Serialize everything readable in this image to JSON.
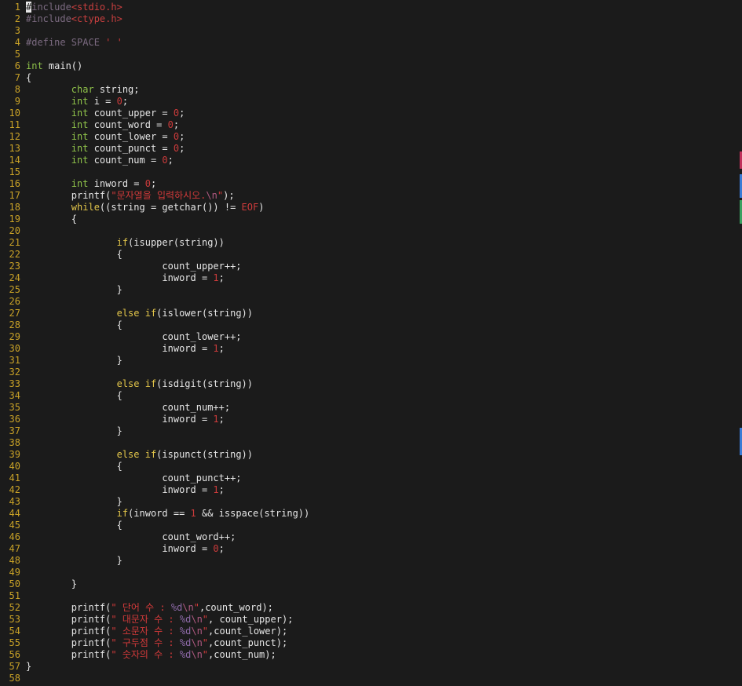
{
  "editor": {
    "colors": {
      "background": "#1b1b1b",
      "line_number": "#c9a227",
      "plain": "#e6e6e6",
      "preproc": "#7b6a80",
      "include_path": "#c83f3f",
      "type_keyword": "#8fc24a",
      "control_keyword": "#e2c54a",
      "number": "#cc3b3b",
      "string": "#d23a3a"
    },
    "lines": [
      {
        "n": "1",
        "tokens": [
          {
            "t": "#",
            "c": "cursor"
          },
          {
            "t": "include",
            "c": "pre"
          },
          {
            "t": "<stdio.h>",
            "c": "inc"
          }
        ]
      },
      {
        "n": "2",
        "tokens": [
          {
            "t": "#include",
            "c": "pre"
          },
          {
            "t": "<ctype.h>",
            "c": "inc"
          }
        ]
      },
      {
        "n": "3",
        "tokens": []
      },
      {
        "n": "4",
        "tokens": [
          {
            "t": "#define SPACE ",
            "c": "pre"
          },
          {
            "t": "' '",
            "c": "str"
          }
        ]
      },
      {
        "n": "5",
        "tokens": []
      },
      {
        "n": "6",
        "tokens": [
          {
            "t": "int",
            "c": "kw"
          },
          {
            "t": " main()",
            "c": "txt"
          }
        ]
      },
      {
        "n": "7",
        "tokens": [
          {
            "t": "{",
            "c": "txt"
          }
        ]
      },
      {
        "n": "8",
        "tokens": [
          {
            "t": "        ",
            "c": "txt"
          },
          {
            "t": "char",
            "c": "kw"
          },
          {
            "t": " string;",
            "c": "txt"
          }
        ]
      },
      {
        "n": "9",
        "tokens": [
          {
            "t": "        ",
            "c": "txt"
          },
          {
            "t": "int",
            "c": "kw"
          },
          {
            "t": " i = ",
            "c": "txt"
          },
          {
            "t": "0",
            "c": "num"
          },
          {
            "t": ";",
            "c": "txt"
          }
        ]
      },
      {
        "n": "10",
        "tokens": [
          {
            "t": "        ",
            "c": "txt"
          },
          {
            "t": "int",
            "c": "kw"
          },
          {
            "t": " count_upper = ",
            "c": "txt"
          },
          {
            "t": "0",
            "c": "num"
          },
          {
            "t": ";",
            "c": "txt"
          }
        ]
      },
      {
        "n": "11",
        "tokens": [
          {
            "t": "        ",
            "c": "txt"
          },
          {
            "t": "int",
            "c": "kw"
          },
          {
            "t": " count_word = ",
            "c": "txt"
          },
          {
            "t": "0",
            "c": "num"
          },
          {
            "t": ";",
            "c": "txt"
          }
        ]
      },
      {
        "n": "12",
        "tokens": [
          {
            "t": "        ",
            "c": "txt"
          },
          {
            "t": "int",
            "c": "kw"
          },
          {
            "t": " count_lower = ",
            "c": "txt"
          },
          {
            "t": "0",
            "c": "num"
          },
          {
            "t": ";",
            "c": "txt"
          }
        ]
      },
      {
        "n": "13",
        "tokens": [
          {
            "t": "        ",
            "c": "txt"
          },
          {
            "t": "int",
            "c": "kw"
          },
          {
            "t": " count_punct = ",
            "c": "txt"
          },
          {
            "t": "0",
            "c": "num"
          },
          {
            "t": ";",
            "c": "txt"
          }
        ]
      },
      {
        "n": "14",
        "tokens": [
          {
            "t": "        ",
            "c": "txt"
          },
          {
            "t": "int",
            "c": "kw"
          },
          {
            "t": " count_num = ",
            "c": "txt"
          },
          {
            "t": "0",
            "c": "num"
          },
          {
            "t": ";",
            "c": "txt"
          }
        ]
      },
      {
        "n": "15",
        "tokens": []
      },
      {
        "n": "16",
        "tokens": [
          {
            "t": "        ",
            "c": "txt"
          },
          {
            "t": "int",
            "c": "kw"
          },
          {
            "t": " inword = ",
            "c": "txt"
          },
          {
            "t": "0",
            "c": "num"
          },
          {
            "t": ";",
            "c": "txt"
          }
        ]
      },
      {
        "n": "17",
        "tokens": [
          {
            "t": "        printf(",
            "c": "txt"
          },
          {
            "t": "\"문자열을 입력하시오.",
            "c": "str"
          },
          {
            "t": "\\n",
            "c": "esc"
          },
          {
            "t": "\"",
            "c": "str"
          },
          {
            "t": ");",
            "c": "txt"
          }
        ]
      },
      {
        "n": "18",
        "tokens": [
          {
            "t": "        ",
            "c": "txt"
          },
          {
            "t": "while",
            "c": "ctl"
          },
          {
            "t": "((string = getchar()) != ",
            "c": "txt"
          },
          {
            "t": "EOF",
            "c": "num"
          },
          {
            "t": ")",
            "c": "txt"
          }
        ]
      },
      {
        "n": "19",
        "tokens": [
          {
            "t": "        {",
            "c": "txt"
          }
        ]
      },
      {
        "n": "20",
        "tokens": []
      },
      {
        "n": "21",
        "tokens": [
          {
            "t": "                ",
            "c": "txt"
          },
          {
            "t": "if",
            "c": "ctl"
          },
          {
            "t": "(isupper(string))",
            "c": "txt"
          }
        ]
      },
      {
        "n": "22",
        "tokens": [
          {
            "t": "                {",
            "c": "txt"
          }
        ]
      },
      {
        "n": "23",
        "tokens": [
          {
            "t": "                        count_upper++;",
            "c": "txt"
          }
        ]
      },
      {
        "n": "24",
        "tokens": [
          {
            "t": "                        inword = ",
            "c": "txt"
          },
          {
            "t": "1",
            "c": "num"
          },
          {
            "t": ";",
            "c": "txt"
          }
        ]
      },
      {
        "n": "25",
        "tokens": [
          {
            "t": "                }",
            "c": "txt"
          }
        ]
      },
      {
        "n": "26",
        "tokens": []
      },
      {
        "n": "27",
        "tokens": [
          {
            "t": "                ",
            "c": "txt"
          },
          {
            "t": "else if",
            "c": "ctl"
          },
          {
            "t": "(islower(string))",
            "c": "txt"
          }
        ]
      },
      {
        "n": "28",
        "tokens": [
          {
            "t": "                {",
            "c": "txt"
          }
        ]
      },
      {
        "n": "29",
        "tokens": [
          {
            "t": "                        count_lower++;",
            "c": "txt"
          }
        ]
      },
      {
        "n": "30",
        "tokens": [
          {
            "t": "                        inword = ",
            "c": "txt"
          },
          {
            "t": "1",
            "c": "num"
          },
          {
            "t": ";",
            "c": "txt"
          }
        ]
      },
      {
        "n": "31",
        "tokens": [
          {
            "t": "                }",
            "c": "txt"
          }
        ]
      },
      {
        "n": "32",
        "tokens": []
      },
      {
        "n": "33",
        "tokens": [
          {
            "t": "                ",
            "c": "txt"
          },
          {
            "t": "else if",
            "c": "ctl"
          },
          {
            "t": "(isdigit(string))",
            "c": "txt"
          }
        ]
      },
      {
        "n": "34",
        "tokens": [
          {
            "t": "                {",
            "c": "txt"
          }
        ]
      },
      {
        "n": "35",
        "tokens": [
          {
            "t": "                        count_num++;",
            "c": "txt"
          }
        ]
      },
      {
        "n": "36",
        "tokens": [
          {
            "t": "                        inword = ",
            "c": "txt"
          },
          {
            "t": "1",
            "c": "num"
          },
          {
            "t": ";",
            "c": "txt"
          }
        ]
      },
      {
        "n": "37",
        "tokens": [
          {
            "t": "                }",
            "c": "txt"
          }
        ]
      },
      {
        "n": "38",
        "tokens": []
      },
      {
        "n": "39",
        "tokens": [
          {
            "t": "                ",
            "c": "txt"
          },
          {
            "t": "else if",
            "c": "ctl"
          },
          {
            "t": "(ispunct(string))",
            "c": "txt"
          }
        ]
      },
      {
        "n": "40",
        "tokens": [
          {
            "t": "                {",
            "c": "txt"
          }
        ]
      },
      {
        "n": "41",
        "tokens": [
          {
            "t": "                        count_punct++;",
            "c": "txt"
          }
        ]
      },
      {
        "n": "42",
        "tokens": [
          {
            "t": "                        inword = ",
            "c": "txt"
          },
          {
            "t": "1",
            "c": "num"
          },
          {
            "t": ";",
            "c": "txt"
          }
        ]
      },
      {
        "n": "43",
        "tokens": [
          {
            "t": "                }",
            "c": "txt"
          }
        ]
      },
      {
        "n": "44",
        "tokens": [
          {
            "t": "                ",
            "c": "txt"
          },
          {
            "t": "if",
            "c": "ctl"
          },
          {
            "t": "(inword == ",
            "c": "txt"
          },
          {
            "t": "1",
            "c": "num"
          },
          {
            "t": " && isspace(string))",
            "c": "txt"
          }
        ]
      },
      {
        "n": "45",
        "tokens": [
          {
            "t": "                {",
            "c": "txt"
          }
        ]
      },
      {
        "n": "46",
        "tokens": [
          {
            "t": "                        count_word++;",
            "c": "txt"
          }
        ]
      },
      {
        "n": "47",
        "tokens": [
          {
            "t": "                        inword = ",
            "c": "txt"
          },
          {
            "t": "0",
            "c": "num"
          },
          {
            "t": ";",
            "c": "txt"
          }
        ]
      },
      {
        "n": "48",
        "tokens": [
          {
            "t": "                }",
            "c": "txt"
          }
        ]
      },
      {
        "n": "49",
        "tokens": []
      },
      {
        "n": "50",
        "tokens": [
          {
            "t": "        }",
            "c": "txt"
          }
        ]
      },
      {
        "n": "51",
        "tokens": []
      },
      {
        "n": "52",
        "tokens": [
          {
            "t": "        printf(",
            "c": "txt"
          },
          {
            "t": "\" 단어 수 : ",
            "c": "str"
          },
          {
            "t": "%d",
            "c": "fmt"
          },
          {
            "t": "\\n",
            "c": "esc"
          },
          {
            "t": "\"",
            "c": "str"
          },
          {
            "t": ",count_word);",
            "c": "txt"
          }
        ]
      },
      {
        "n": "53",
        "tokens": [
          {
            "t": "        printf(",
            "c": "txt"
          },
          {
            "t": "\" 대문자 수 : ",
            "c": "str"
          },
          {
            "t": "%d",
            "c": "fmt"
          },
          {
            "t": "\\n",
            "c": "esc"
          },
          {
            "t": "\"",
            "c": "str"
          },
          {
            "t": ", count_upper);",
            "c": "txt"
          }
        ]
      },
      {
        "n": "54",
        "tokens": [
          {
            "t": "        printf(",
            "c": "txt"
          },
          {
            "t": "\" 소문자 수 : ",
            "c": "str"
          },
          {
            "t": "%d",
            "c": "fmt"
          },
          {
            "t": "\\n",
            "c": "esc"
          },
          {
            "t": "\"",
            "c": "str"
          },
          {
            "t": ",count_lower);",
            "c": "txt"
          }
        ]
      },
      {
        "n": "55",
        "tokens": [
          {
            "t": "        printf(",
            "c": "txt"
          },
          {
            "t": "\" 구두점 수 : ",
            "c": "str"
          },
          {
            "t": "%d",
            "c": "fmt"
          },
          {
            "t": "\\n",
            "c": "esc"
          },
          {
            "t": "\"",
            "c": "str"
          },
          {
            "t": ",count_punct);",
            "c": "txt"
          }
        ]
      },
      {
        "n": "56",
        "tokens": [
          {
            "t": "        printf(",
            "c": "txt"
          },
          {
            "t": "\" 숫자의 수 : ",
            "c": "str"
          },
          {
            "t": "%d",
            "c": "fmt"
          },
          {
            "t": "\\n",
            "c": "esc"
          },
          {
            "t": "\"",
            "c": "str"
          },
          {
            "t": ",count_num);",
            "c": "txt"
          }
        ]
      },
      {
        "n": "57",
        "tokens": [
          {
            "t": "}",
            "c": "txt"
          }
        ]
      },
      {
        "n": "58",
        "tokens": []
      }
    ]
  }
}
